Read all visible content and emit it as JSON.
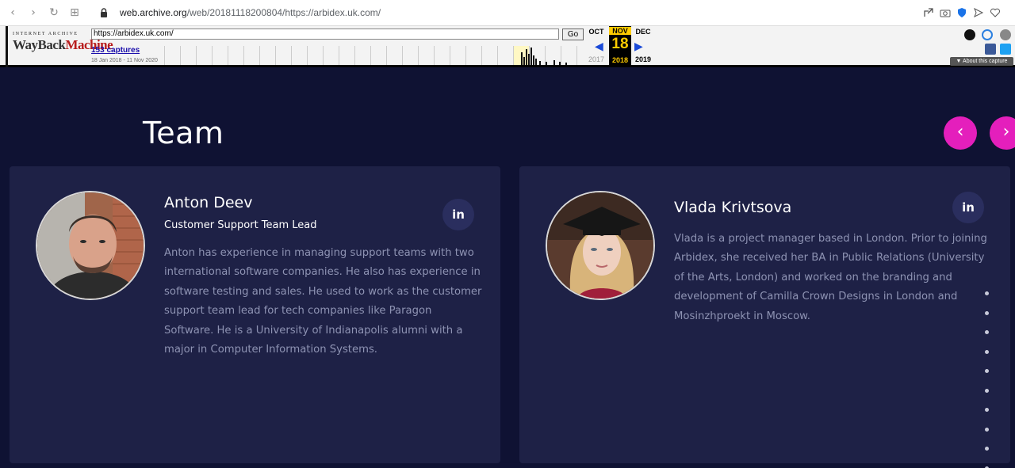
{
  "browser": {
    "url_prefix": "web.archive.org",
    "url_rest": "/web/20181118200804/https://arbidex.uk.com/"
  },
  "wayback": {
    "logo_top": "INTERNET ARCHIVE",
    "logo_main": "WayBack",
    "logo_main2": "Machine",
    "url_value": "https://arbidex.uk.com/",
    "go_label": "Go",
    "captures": "153 captures",
    "range": "18 Jan 2018 - 11 Nov 2020",
    "prev_month": "OCT",
    "cur_month": "NOV",
    "next_month": "DEC",
    "cur_day": "18",
    "prev_year": "2017",
    "cur_year": "2018",
    "next_year": "2019",
    "about": "About this capture"
  },
  "page": {
    "title": "Team",
    "accent": "#e41fbc",
    "prev_label": "‹",
    "next_label": "›"
  },
  "team": [
    {
      "name": "Anton Deev",
      "role": "Customer Support Team Lead",
      "bio_lines": [
        "Anton has experience in managing support teams with two",
        "international software companies. He also has experience in",
        "software testing and sales. He used to work as the customer",
        "support team lead for tech companies like Paragon",
        "Software. He is a University of Indianapolis alumni with a",
        "major in Computer Information Systems."
      ],
      "linkedin": "in"
    },
    {
      "name": "Vlada Krivtsova",
      "role": "",
      "bio_lines": [
        "Vlada is a project manager based in London. Prior to joining",
        "Arbidex, she received her BA in Public Relations (University",
        "of the Arts, London) and worked on the branding and",
        "development of Camilla Crown Designs in London and",
        "Mosinzhproekt in Moscow."
      ],
      "linkedin": "in"
    }
  ]
}
